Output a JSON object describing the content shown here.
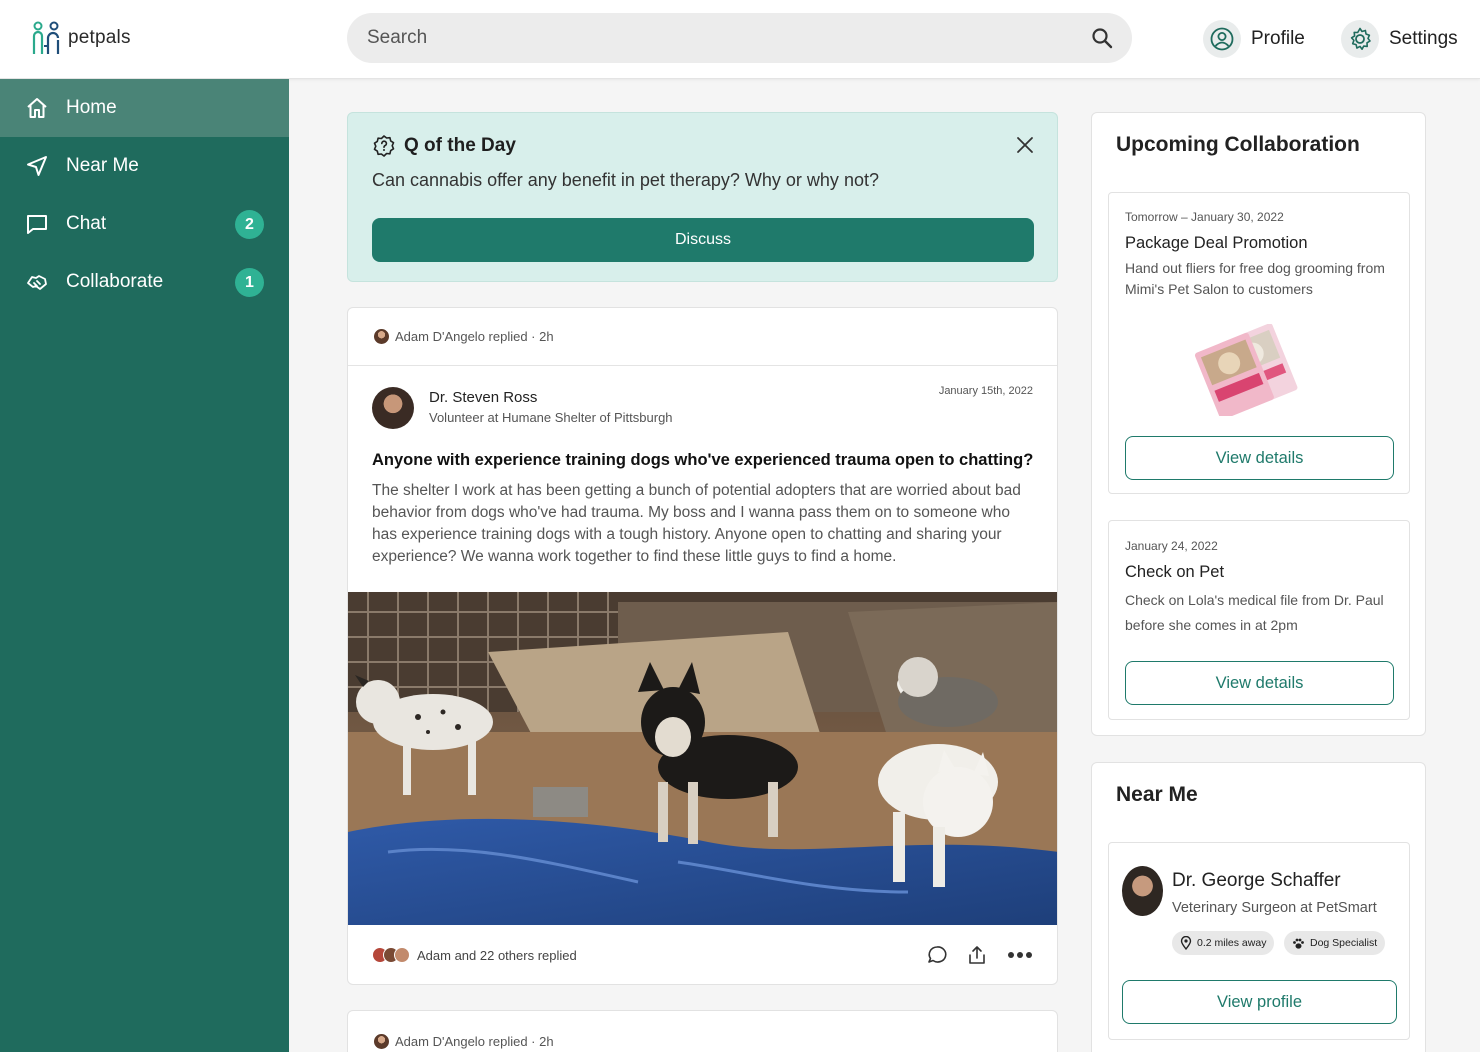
{
  "app": {
    "logo_text": "petpals"
  },
  "search": {
    "placeholder": "Search"
  },
  "header": {
    "profile_label": "Profile",
    "settings_label": "Settings"
  },
  "sidebar": {
    "items": [
      {
        "label": "Home",
        "icon": "home-icon",
        "active": true
      },
      {
        "label": "Near Me",
        "icon": "navigation-arrow-icon"
      },
      {
        "label": "Chat",
        "icon": "chat-bubble-icon",
        "badge": "2"
      },
      {
        "label": "Collaborate",
        "icon": "handshake-icon",
        "badge": "1"
      }
    ]
  },
  "qotd": {
    "title": "Q of the Day",
    "question": "Can cannabis offer any benefit in pet therapy? Why or why not?",
    "button_label": "Discuss"
  },
  "post": {
    "reply_note": "Adam D'Angelo replied · 2h",
    "author_name": "Dr. Steven Ross",
    "author_role": "Volunteer at Humane Shelter of Pittsburgh",
    "date": "January 15th, 2022",
    "title": "Anyone with experience training dogs who've experienced trauma open to chatting?",
    "body": "The shelter I work at has been getting a bunch of potential adopters that are worried about bad behavior from dogs who've had trauma. My boss and I wanna pass them on to someone who has experience training dogs with a tough history. Anyone open to chatting and sharing your experience? We wanna work together to find these little guys to find a home.",
    "replies_summary": "Adam and 22 others replied"
  },
  "post2": {
    "reply_note": "Adam D'Angelo replied · 2h"
  },
  "collaboration": {
    "title": "Upcoming Collaboration",
    "items": [
      {
        "date": "Tomorrow – January 30, 2022",
        "title": "Package Deal Promotion",
        "description": "Hand out fliers for free dog grooming from Mimi's Pet Salon to customers",
        "button_label": "View details"
      },
      {
        "date": "January 24, 2022",
        "title": "Check on Pet",
        "description": "Check on Lola's medical file from Dr. Paul before she comes in at 2pm",
        "button_label": "View details"
      }
    ]
  },
  "near_me": {
    "title": "Near Me",
    "name": "Dr. George Schaffer",
    "role": "Veterinary Surgeon at PetSmart",
    "distance": "0.2 miles away",
    "specialty": "Dog Specialist",
    "button_label": "View profile"
  },
  "colors": {
    "sidebar": "#1f6b5d",
    "accent": "#1f7a6b",
    "badge": "#2fb294",
    "qotd_bg": "#d8efeb"
  }
}
